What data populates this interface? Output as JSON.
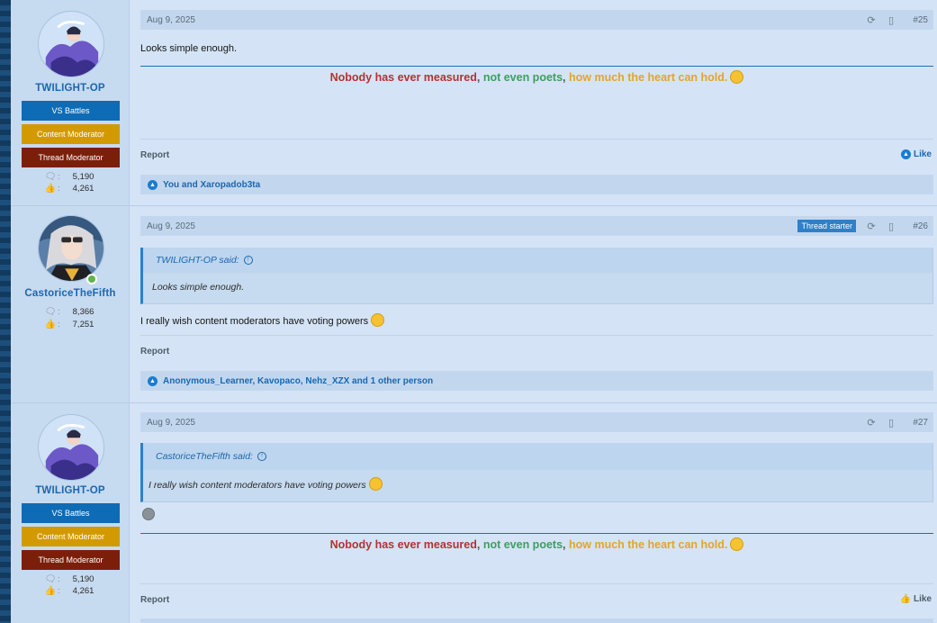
{
  "posts": [
    {
      "user": {
        "name": "TWILIGHT-OP",
        "banners": [
          "VS Battles",
          "Content Moderator",
          "Thread Moderator"
        ],
        "messages": "5,190",
        "reactions": "4,261"
      },
      "date": "Aug 9, 2025",
      "number": "#25",
      "body": "Looks simple enough.",
      "signature": {
        "part1": "Nobody has ever measured",
        "sep1": ",",
        "part2": " not even poets",
        "sep2": ",",
        "part3": " how much the heart can hold."
      },
      "report_label": "Report",
      "like_label": "Like",
      "reaction_summary": "You and Xaropadob3ta"
    },
    {
      "user": {
        "name": "CastoriceTheFifth",
        "messages": "8,366",
        "reactions": "7,251"
      },
      "date": "Aug 9, 2025",
      "tag": "Thread starter",
      "number": "#26",
      "quote": {
        "author": "TWILIGHT-OP said:",
        "text": "Looks simple enough."
      },
      "body": "I really wish content moderators have voting powers",
      "report_label": "Report",
      "reaction_summary": "Anonymous_Learner, Kavopaco, Nehz_XZX and 1 other person"
    },
    {
      "user": {
        "name": "TWILIGHT-OP",
        "banners": [
          "VS Battles",
          "Content Moderator",
          "Thread Moderator"
        ],
        "messages": "5,190",
        "reactions": "4,261"
      },
      "date": "Aug 9, 2025",
      "number": "#27",
      "quote": {
        "author": "CastoriceTheFifth said:",
        "text": "I really wish content moderators have voting powers"
      },
      "signature": {
        "part1": "Nobody has ever measured",
        "sep1": ",",
        "part2": " not even poets",
        "sep2": ",",
        "part3": " how much the heart can hold."
      },
      "report_label": "Report",
      "like_label": "Like"
    }
  ],
  "colors": {
    "accent": "#1a67b0",
    "vs_banner": "#0e6bb5",
    "content_mod_banner": "#d39a00",
    "thread_mod_banner": "#7b1f0b",
    "sig_red": "#b33232",
    "sig_green": "#3f9e5f",
    "sig_gold": "#e2a52a"
  },
  "icons": {
    "share": "share-icon",
    "bookmark": "bookmark-icon",
    "messages": "messages-icon",
    "reactions": "thumbs-up-icon",
    "quote_jump": "arrow-up-circle-icon"
  }
}
